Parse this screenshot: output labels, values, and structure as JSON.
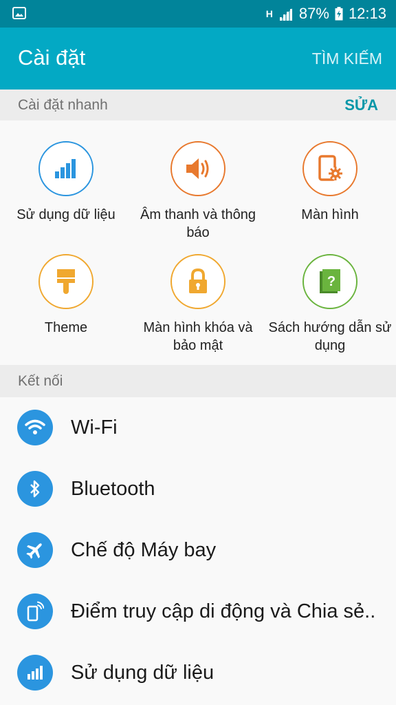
{
  "status_bar": {
    "network_type": "H",
    "battery_percent": "87%",
    "time": "12:13"
  },
  "app_bar": {
    "title": "Cài đặt",
    "search_label": "TÌM KIẾM"
  },
  "quick_settings": {
    "header": "Cài đặt nhanh",
    "edit_label": "SỬA",
    "tiles": [
      {
        "label": "Sử dụng dữ liệu",
        "icon": "data-usage-icon",
        "color": "#2b95df"
      },
      {
        "label": "Âm thanh và thông báo",
        "icon": "speaker-icon",
        "color": "#e8792e"
      },
      {
        "label": "Màn hình",
        "icon": "display-settings-icon",
        "color": "#e8792e"
      },
      {
        "label": "Theme",
        "icon": "paintbrush-icon",
        "color": "#f0a830"
      },
      {
        "label": "Màn hình khóa và bảo mật",
        "icon": "lock-icon",
        "color": "#f0a830"
      },
      {
        "label": "Sách hướng dẫn sử dụng",
        "icon": "help-book-icon",
        "color": "#6ab43e"
      }
    ]
  },
  "connections": {
    "header": "Kết nối",
    "items": [
      {
        "label": "Wi-Fi",
        "icon": "wifi-icon"
      },
      {
        "label": "Bluetooth",
        "icon": "bluetooth-icon"
      },
      {
        "label": "Chế độ Máy bay",
        "icon": "airplane-icon"
      },
      {
        "label": "Điểm truy cập di động và Chia sẻ..",
        "icon": "hotspot-icon"
      },
      {
        "label": "Sử dụng dữ liệu",
        "icon": "data-usage-icon"
      }
    ]
  },
  "colors": {
    "status_bar": "#01849a",
    "app_bar": "#03a9c4",
    "accent": "#0597a8",
    "list_icon": "#2b95df"
  }
}
